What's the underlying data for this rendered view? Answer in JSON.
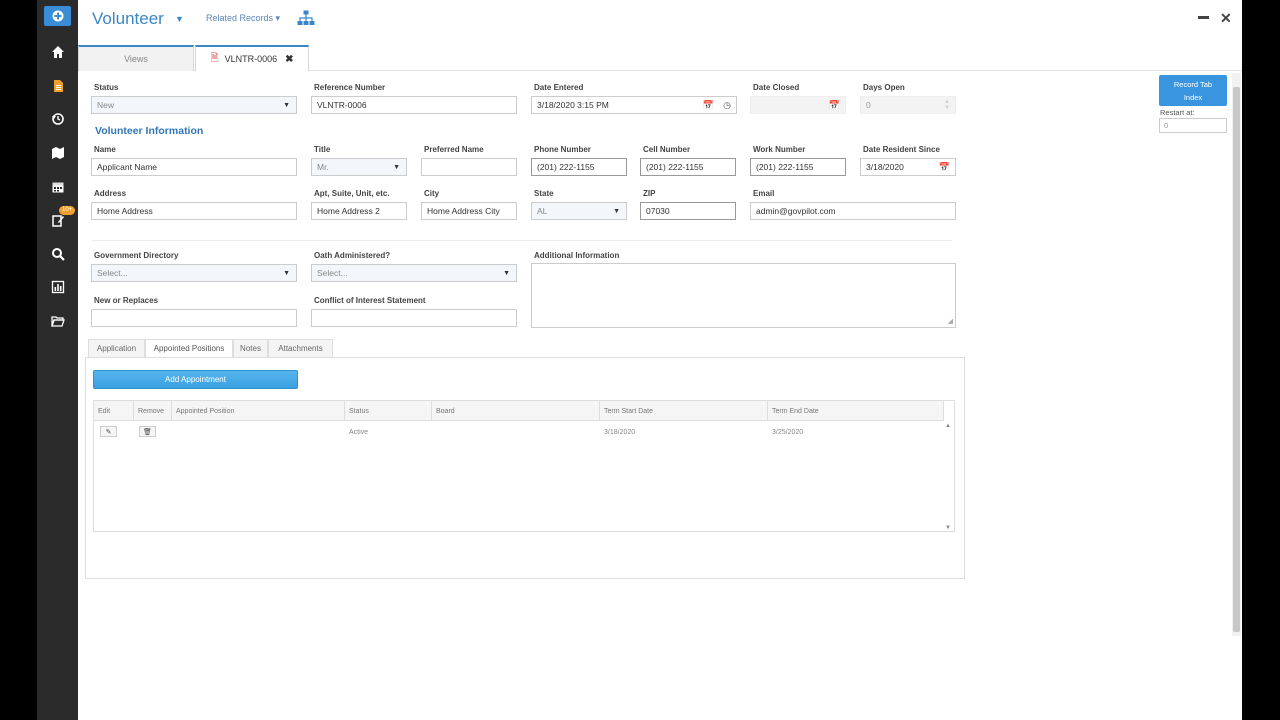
{
  "app": {
    "title": "Volunteer",
    "related_records": "Related Records ▾"
  },
  "tabs": {
    "views": "Views",
    "record": "VLNTR-0006"
  },
  "sidebar": {
    "badge": "10+"
  },
  "fields": {
    "status": {
      "label": "Status",
      "value": "New"
    },
    "reference_number": {
      "label": "Reference Number",
      "value": "VLNTR-0006"
    },
    "date_entered": {
      "label": "Date Entered",
      "value": "3/18/2020 3:15 PM"
    },
    "date_closed": {
      "label": "Date Closed",
      "value": ""
    },
    "days_open": {
      "label": "Days Open",
      "value": "0"
    },
    "section_title": "Volunteer Information",
    "name": {
      "label": "Name",
      "value": "Applicant Name"
    },
    "title": {
      "label": "Title",
      "value": "Mr."
    },
    "preferred_name": {
      "label": "Preferred Name",
      "value": ""
    },
    "phone_number": {
      "label": "Phone Number",
      "value": "(201) 222-1155"
    },
    "cell_number": {
      "label": "Cell Number",
      "value": "(201) 222-1155"
    },
    "work_number": {
      "label": "Work Number",
      "value": "(201) 222-1155"
    },
    "date_resident_since": {
      "label": "Date Resident Since",
      "value": "3/18/2020"
    },
    "address": {
      "label": "Address",
      "value": "Home Address"
    },
    "apt": {
      "label": "Apt, Suite, Unit, etc.",
      "value": "Home Address 2"
    },
    "city": {
      "label": "City",
      "value": "Home Address City"
    },
    "state": {
      "label": "State",
      "value": "AL"
    },
    "zip": {
      "label": "ZIP",
      "value": "07030"
    },
    "email": {
      "label": "Email",
      "value": "admin@govpilot.com"
    },
    "gov_directory": {
      "label": "Government Directory",
      "value": "Select..."
    },
    "oath": {
      "label": "Oath Administered?",
      "value": "Select..."
    },
    "additional_info": {
      "label": "Additional Information",
      "value": ""
    },
    "new_or_replaces": {
      "label": "New or Replaces",
      "value": ""
    },
    "conflict": {
      "label": "Conflict of Interest Statement",
      "value": ""
    }
  },
  "subtabs": [
    "Application",
    "Appointed Positions",
    "Notes",
    "Attachments"
  ],
  "appointments": {
    "add_button": "Add Appointment",
    "columns": [
      "Edit",
      "Remove",
      "Appointed Position",
      "Status",
      "Board",
      "Term Start Date",
      "Term End Date"
    ],
    "rows": [
      {
        "position": "",
        "status": "Active",
        "board": "",
        "term_start": "3/18/2020",
        "term_end": "3/25/2020"
      }
    ]
  },
  "record_tab_index": {
    "button": "Record Tab Index",
    "restart_label": "Restart at:",
    "restart_value": "0"
  }
}
